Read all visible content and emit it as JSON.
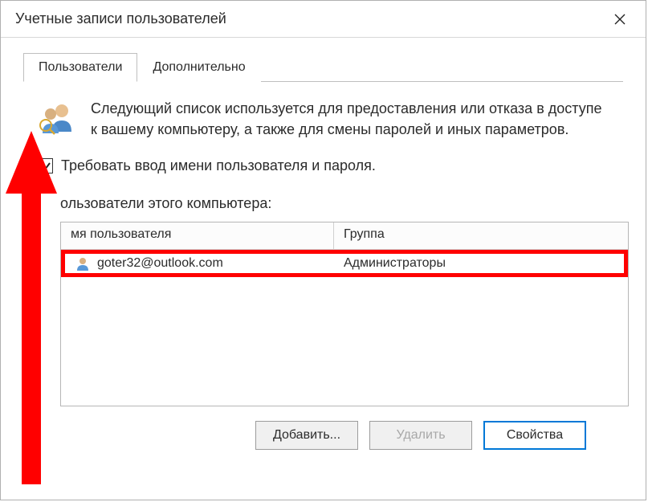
{
  "window": {
    "title": "Учетные записи пользователей"
  },
  "tabs": {
    "users": "Пользователи",
    "advanced": "Дополнительно"
  },
  "info": {
    "text": "Следующий список используется для предоставления или отказа в доступе к вашему компьютеру, а также для смены паролей и иных параметров."
  },
  "checkbox": {
    "label": "Требовать ввод имени пользователя и пароля.",
    "checked": true
  },
  "list": {
    "label": "ользователи этого компьютера:",
    "columns": {
      "user": "мя пользователя",
      "group": "Группа"
    },
    "rows": [
      {
        "user": "goter32@outlook.com",
        "group": "Администраторы"
      }
    ]
  },
  "buttons": {
    "add": "Добавить...",
    "remove": "Удалить",
    "properties": "Свойства"
  }
}
